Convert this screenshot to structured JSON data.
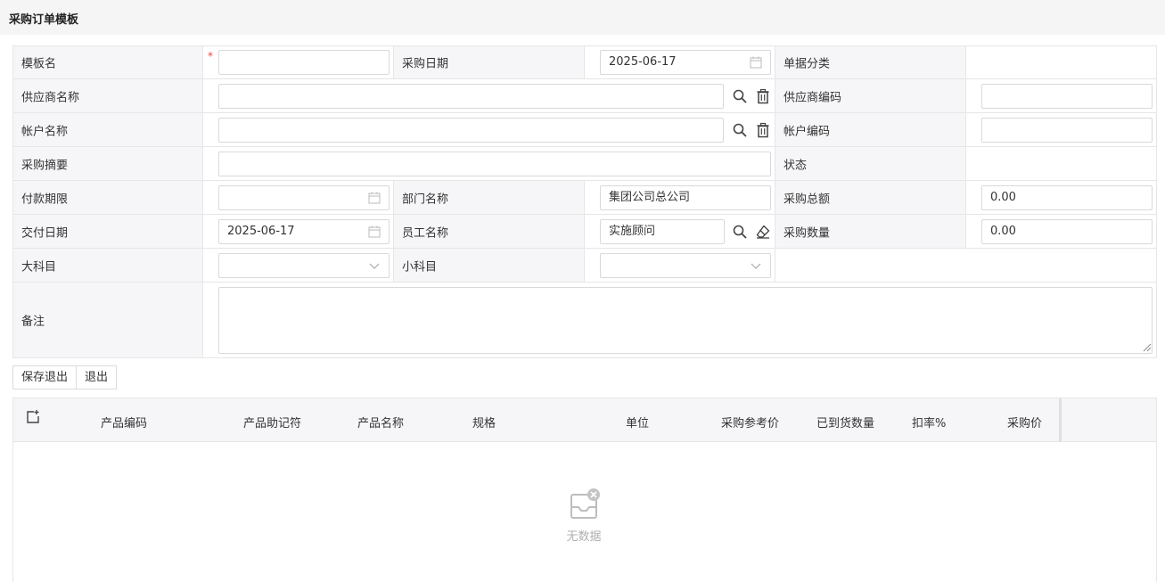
{
  "page": {
    "title": "采购订单模板"
  },
  "form": {
    "template_name": {
      "label": "模板名",
      "value": "",
      "required_mark": "*"
    },
    "purchase_date": {
      "label": "采购日期",
      "value": "2025-06-17"
    },
    "doc_category": {
      "label": "单据分类",
      "value": ""
    },
    "supplier_name": {
      "label": "供应商名称",
      "value": ""
    },
    "supplier_code": {
      "label": "供应商编码",
      "value": ""
    },
    "account_name": {
      "label": "帐户名称",
      "value": ""
    },
    "account_code": {
      "label": "帐户编码",
      "value": ""
    },
    "purchase_summary": {
      "label": "采购摘要",
      "value": ""
    },
    "status": {
      "label": "状态",
      "value": ""
    },
    "payment_term": {
      "label": "付款期限",
      "value": ""
    },
    "department_name": {
      "label": "部门名称",
      "value": "集团公司总公司"
    },
    "total_amount": {
      "label": "采购总额",
      "value": "0.00"
    },
    "delivery_date": {
      "label": "交付日期",
      "value": "2025-06-17"
    },
    "employee_name": {
      "label": "员工名称",
      "value": "实施顾问"
    },
    "purchase_qty": {
      "label": "采购数量",
      "value": "0.00"
    },
    "major_subject": {
      "label": "大科目",
      "value": ""
    },
    "minor_subject": {
      "label": "小科目",
      "value": ""
    },
    "remarks": {
      "label": "备注",
      "value": ""
    }
  },
  "actions": {
    "save_exit": "保存退出",
    "exit": "退出"
  },
  "table": {
    "columns": [
      "产品编码",
      "产品助记符",
      "产品名称",
      "规格",
      "单位",
      "采购参考价",
      "已到货数量",
      "扣率%",
      "采购价"
    ],
    "rows": [],
    "empty_text": "无数据"
  },
  "icons": {
    "search": "search-icon",
    "delete": "trash-icon",
    "clear": "eraser-icon",
    "calendar": "calendar-icon",
    "dropdown": "chevron-down-icon",
    "add_row": "add-row-icon",
    "empty": "empty-box-icon"
  },
  "colors": {
    "required": "#e74c3c",
    "label_bg": "#f6f6f8",
    "border": "#e6e6e6"
  }
}
